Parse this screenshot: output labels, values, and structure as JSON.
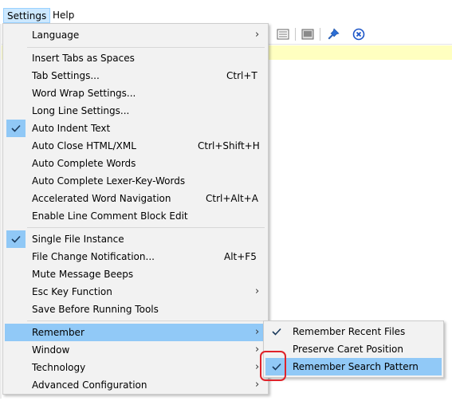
{
  "menubar": {
    "settings": "Settings",
    "help": "Help"
  },
  "toolbar": {
    "icons": [
      "doc-view-icon",
      "image-icon",
      "pin-icon",
      "close-circle-icon"
    ]
  },
  "settings_menu": {
    "language": "Language",
    "insert_tabs": "Insert Tabs as Spaces",
    "tab_settings": "Tab Settings...",
    "tab_settings_sc": "Ctrl+T",
    "word_wrap": "Word Wrap Settings...",
    "long_line": "Long Line Settings...",
    "auto_indent": "Auto Indent Text",
    "auto_close": "Auto Close HTML/XML",
    "auto_close_sc": "Ctrl+Shift+H",
    "auto_complete_words": "Auto Complete Words",
    "auto_complete_lexer": "Auto Complete Lexer-Key-Words",
    "accel_nav": "Accelerated Word Navigation",
    "accel_nav_sc": "Ctrl+Alt+A",
    "line_comment": "Enable Line Comment Block Edit",
    "single_instance": "Single File Instance",
    "file_change": "File Change Notification...",
    "file_change_sc": "Alt+F5",
    "mute_beeps": "Mute Message Beeps",
    "esc_key": "Esc Key Function",
    "save_before": "Save Before Running Tools",
    "remember": "Remember",
    "window": "Window",
    "technology": "Technology",
    "advanced": "Advanced Configuration"
  },
  "remember_submenu": {
    "recent_files": "Remember Recent Files",
    "caret_position": "Preserve Caret Position",
    "search_pattern": "Remember Search Pattern"
  },
  "colors": {
    "highlight": "#91c9f7",
    "check_bg": "#90c8f6",
    "callout": "#e0232a",
    "editor_band": "#ffffc0"
  }
}
